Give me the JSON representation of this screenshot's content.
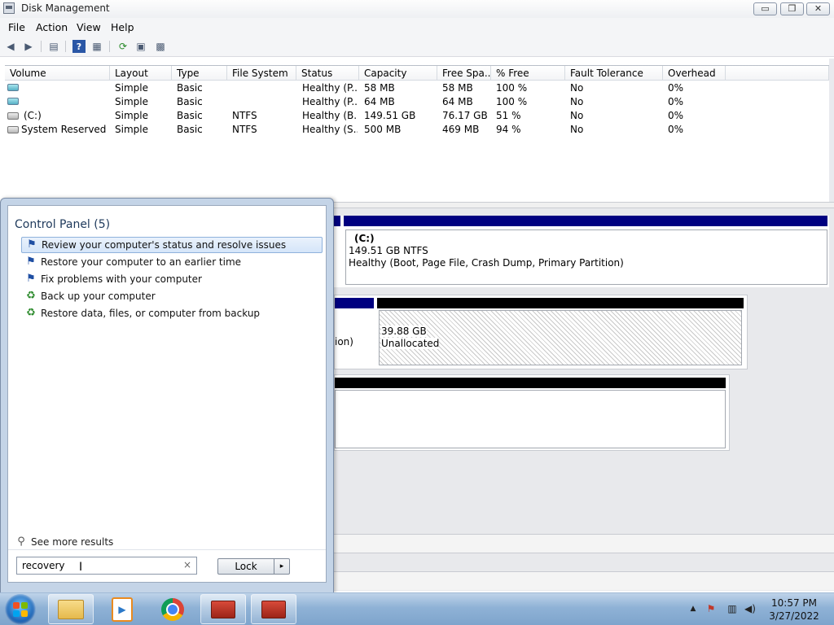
{
  "window": {
    "title": "Disk Management",
    "controls": {
      "minimize": "▭",
      "maximize": "❐",
      "close": "✕"
    }
  },
  "menu": [
    "File",
    "Action",
    "View",
    "Help"
  ],
  "toolbar_icons": [
    "back-arrow-icon",
    "forward-arrow-icon",
    "console-tree-icon",
    "help-icon",
    "properties-icon",
    "refresh-icon",
    "rescan-icon",
    "settings-icon"
  ],
  "volume_list": {
    "columns": [
      "Volume",
      "Layout",
      "Type",
      "File System",
      "Status",
      "Capacity",
      "Free Spa...",
      "% Free",
      "Fault Tolerance",
      "Overhead"
    ],
    "rows": [
      {
        "volume": "",
        "layout": "Simple",
        "type": "Basic",
        "fs": "",
        "status": "Healthy (P...",
        "capacity": "58 MB",
        "free": "58 MB",
        "pct": "100 %",
        "fault": "No",
        "overhead": "0%"
      },
      {
        "volume": "",
        "layout": "Simple",
        "type": "Basic",
        "fs": "",
        "status": "Healthy (P...",
        "capacity": "64 MB",
        "free": "64 MB",
        "pct": "100 %",
        "fault": "No",
        "overhead": "0%"
      },
      {
        "volume": "(C:)",
        "layout": "Simple",
        "type": "Basic",
        "fs": "NTFS",
        "status": "Healthy (B...",
        "capacity": "149.51 GB",
        "free": "76.17 GB",
        "pct": "51 %",
        "fault": "No",
        "overhead": "0%"
      },
      {
        "volume": "System Reserved",
        "layout": "Simple",
        "type": "Basic",
        "fs": "NTFS",
        "status": "Healthy (S...",
        "capacity": "500 MB",
        "free": "469 MB",
        "pct": "94 %",
        "fault": "No",
        "overhead": "0%"
      }
    ]
  },
  "graphical": {
    "c_partition": {
      "name": "(C:)",
      "size": "149.51 GB NTFS",
      "status": "Healthy (Boot, Page File, Crash Dump, Primary Partition)"
    },
    "partial_label": "ion)",
    "unallocated": {
      "size": "39.88 GB",
      "label": "Unallocated"
    }
  },
  "start_menu": {
    "heading": "Control Panel (5)",
    "items": [
      {
        "label": "Review your computer's status and resolve issues",
        "icon": "flag-icon"
      },
      {
        "label": "Restore your computer to an earlier time",
        "icon": "flag-icon"
      },
      {
        "label": "Fix problems with your computer",
        "icon": "flag-icon"
      },
      {
        "label": "Back up your computer",
        "icon": "backup-icon"
      },
      {
        "label": "Restore data, files, or computer from backup",
        "icon": "backup-icon"
      }
    ],
    "see_more": "See more results",
    "search_value": "recovery",
    "clear_glyph": "×",
    "lock_label": "Lock",
    "lock_arrow": "▸"
  },
  "taskbar": {
    "apps": [
      "file-explorer-icon",
      "media-player-icon",
      "chrome-icon",
      "toolbox-icon",
      "toolbox-icon"
    ],
    "clock_time": "10:57 PM",
    "clock_date": "3/27/2022"
  },
  "colors": {
    "partition_header": "#000080",
    "unallocated_header": "#000000",
    "selection": "#d5e5f9"
  }
}
